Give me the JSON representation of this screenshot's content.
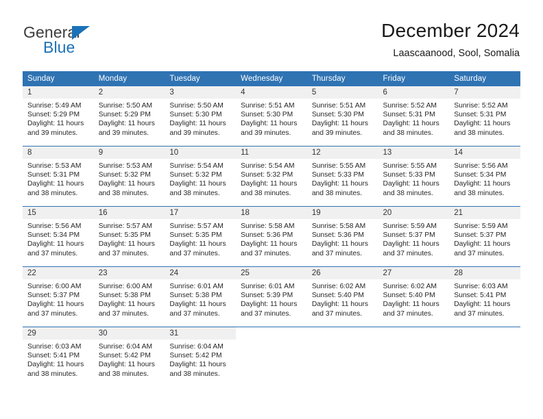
{
  "brand": {
    "name_top": "General",
    "name_bottom": "Blue",
    "triangle_color": "#1b72b8",
    "text_color": "#3c3c3c"
  },
  "header": {
    "title": "December 2024",
    "subtitle": "Laascaanood, Sool, Somalia"
  },
  "theme": {
    "header_blue": "#2f73b3",
    "daynum_gray": "#f0f0f0",
    "body_text": "#262626",
    "page_background": "#ffffff"
  },
  "calendar": {
    "weekday_headers": [
      "Sunday",
      "Monday",
      "Tuesday",
      "Wednesday",
      "Thursday",
      "Friday",
      "Saturday"
    ],
    "weeks": [
      [
        {
          "day": "1",
          "sunrise": "Sunrise: 5:49 AM",
          "sunset": "Sunset: 5:29 PM",
          "daylight": "Daylight: 11 hours and 39 minutes."
        },
        {
          "day": "2",
          "sunrise": "Sunrise: 5:50 AM",
          "sunset": "Sunset: 5:29 PM",
          "daylight": "Daylight: 11 hours and 39 minutes."
        },
        {
          "day": "3",
          "sunrise": "Sunrise: 5:50 AM",
          "sunset": "Sunset: 5:30 PM",
          "daylight": "Daylight: 11 hours and 39 minutes."
        },
        {
          "day": "4",
          "sunrise": "Sunrise: 5:51 AM",
          "sunset": "Sunset: 5:30 PM",
          "daylight": "Daylight: 11 hours and 39 minutes."
        },
        {
          "day": "5",
          "sunrise": "Sunrise: 5:51 AM",
          "sunset": "Sunset: 5:30 PM",
          "daylight": "Daylight: 11 hours and 39 minutes."
        },
        {
          "day": "6",
          "sunrise": "Sunrise: 5:52 AM",
          "sunset": "Sunset: 5:31 PM",
          "daylight": "Daylight: 11 hours and 38 minutes."
        },
        {
          "day": "7",
          "sunrise": "Sunrise: 5:52 AM",
          "sunset": "Sunset: 5:31 PM",
          "daylight": "Daylight: 11 hours and 38 minutes."
        }
      ],
      [
        {
          "day": "8",
          "sunrise": "Sunrise: 5:53 AM",
          "sunset": "Sunset: 5:31 PM",
          "daylight": "Daylight: 11 hours and 38 minutes."
        },
        {
          "day": "9",
          "sunrise": "Sunrise: 5:53 AM",
          "sunset": "Sunset: 5:32 PM",
          "daylight": "Daylight: 11 hours and 38 minutes."
        },
        {
          "day": "10",
          "sunrise": "Sunrise: 5:54 AM",
          "sunset": "Sunset: 5:32 PM",
          "daylight": "Daylight: 11 hours and 38 minutes."
        },
        {
          "day": "11",
          "sunrise": "Sunrise: 5:54 AM",
          "sunset": "Sunset: 5:32 PM",
          "daylight": "Daylight: 11 hours and 38 minutes."
        },
        {
          "day": "12",
          "sunrise": "Sunrise: 5:55 AM",
          "sunset": "Sunset: 5:33 PM",
          "daylight": "Daylight: 11 hours and 38 minutes."
        },
        {
          "day": "13",
          "sunrise": "Sunrise: 5:55 AM",
          "sunset": "Sunset: 5:33 PM",
          "daylight": "Daylight: 11 hours and 38 minutes."
        },
        {
          "day": "14",
          "sunrise": "Sunrise: 5:56 AM",
          "sunset": "Sunset: 5:34 PM",
          "daylight": "Daylight: 11 hours and 38 minutes."
        }
      ],
      [
        {
          "day": "15",
          "sunrise": "Sunrise: 5:56 AM",
          "sunset": "Sunset: 5:34 PM",
          "daylight": "Daylight: 11 hours and 37 minutes."
        },
        {
          "day": "16",
          "sunrise": "Sunrise: 5:57 AM",
          "sunset": "Sunset: 5:35 PM",
          "daylight": "Daylight: 11 hours and 37 minutes."
        },
        {
          "day": "17",
          "sunrise": "Sunrise: 5:57 AM",
          "sunset": "Sunset: 5:35 PM",
          "daylight": "Daylight: 11 hours and 37 minutes."
        },
        {
          "day": "18",
          "sunrise": "Sunrise: 5:58 AM",
          "sunset": "Sunset: 5:36 PM",
          "daylight": "Daylight: 11 hours and 37 minutes."
        },
        {
          "day": "19",
          "sunrise": "Sunrise: 5:58 AM",
          "sunset": "Sunset: 5:36 PM",
          "daylight": "Daylight: 11 hours and 37 minutes."
        },
        {
          "day": "20",
          "sunrise": "Sunrise: 5:59 AM",
          "sunset": "Sunset: 5:37 PM",
          "daylight": "Daylight: 11 hours and 37 minutes."
        },
        {
          "day": "21",
          "sunrise": "Sunrise: 5:59 AM",
          "sunset": "Sunset: 5:37 PM",
          "daylight": "Daylight: 11 hours and 37 minutes."
        }
      ],
      [
        {
          "day": "22",
          "sunrise": "Sunrise: 6:00 AM",
          "sunset": "Sunset: 5:37 PM",
          "daylight": "Daylight: 11 hours and 37 minutes."
        },
        {
          "day": "23",
          "sunrise": "Sunrise: 6:00 AM",
          "sunset": "Sunset: 5:38 PM",
          "daylight": "Daylight: 11 hours and 37 minutes."
        },
        {
          "day": "24",
          "sunrise": "Sunrise: 6:01 AM",
          "sunset": "Sunset: 5:38 PM",
          "daylight": "Daylight: 11 hours and 37 minutes."
        },
        {
          "day": "25",
          "sunrise": "Sunrise: 6:01 AM",
          "sunset": "Sunset: 5:39 PM",
          "daylight": "Daylight: 11 hours and 37 minutes."
        },
        {
          "day": "26",
          "sunrise": "Sunrise: 6:02 AM",
          "sunset": "Sunset: 5:40 PM",
          "daylight": "Daylight: 11 hours and 37 minutes."
        },
        {
          "day": "27",
          "sunrise": "Sunrise: 6:02 AM",
          "sunset": "Sunset: 5:40 PM",
          "daylight": "Daylight: 11 hours and 37 minutes."
        },
        {
          "day": "28",
          "sunrise": "Sunrise: 6:03 AM",
          "sunset": "Sunset: 5:41 PM",
          "daylight": "Daylight: 11 hours and 37 minutes."
        }
      ],
      [
        {
          "day": "29",
          "sunrise": "Sunrise: 6:03 AM",
          "sunset": "Sunset: 5:41 PM",
          "daylight": "Daylight: 11 hours and 38 minutes."
        },
        {
          "day": "30",
          "sunrise": "Sunrise: 6:04 AM",
          "sunset": "Sunset: 5:42 PM",
          "daylight": "Daylight: 11 hours and 38 minutes."
        },
        {
          "day": "31",
          "sunrise": "Sunrise: 6:04 AM",
          "sunset": "Sunset: 5:42 PM",
          "daylight": "Daylight: 11 hours and 38 minutes."
        },
        {
          "day": "",
          "sunrise": "",
          "sunset": "",
          "daylight": ""
        },
        {
          "day": "",
          "sunrise": "",
          "sunset": "",
          "daylight": ""
        },
        {
          "day": "",
          "sunrise": "",
          "sunset": "",
          "daylight": ""
        },
        {
          "day": "",
          "sunrise": "",
          "sunset": "",
          "daylight": ""
        }
      ]
    ]
  }
}
